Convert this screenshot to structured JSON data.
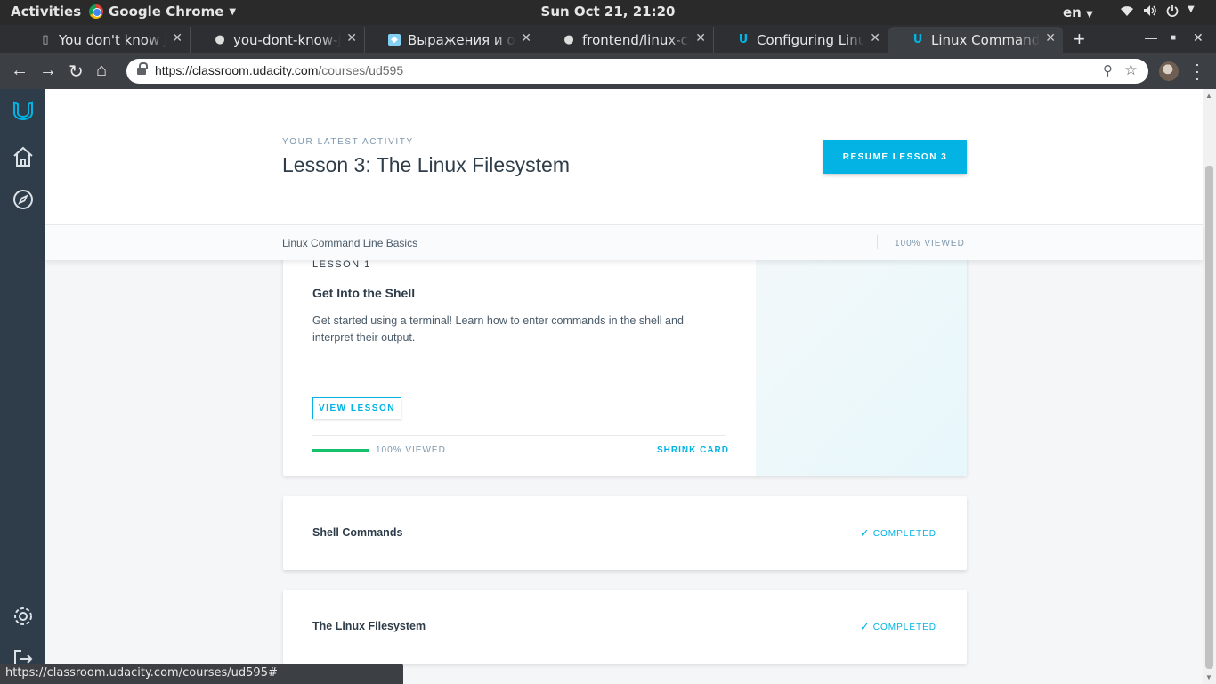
{
  "system_bar": {
    "activities": "Activities",
    "app_name": "Google Chrome",
    "clock": "Sun Oct 21, 21:20",
    "lang": "en"
  },
  "tabs": [
    {
      "title": "You don't know JS",
      "icon": "document-icon"
    },
    {
      "title": "you-dont-know-js-ru",
      "icon": "github-icon"
    },
    {
      "title": "Выражения и операторы",
      "icon": "mdn-icon"
    },
    {
      "title": "frontend/linux-cli-hw",
      "icon": "github-icon"
    },
    {
      "title": "Configuring Linux Web",
      "icon": "udacity-icon"
    },
    {
      "title": "Linux Command Line",
      "icon": "udacity-icon",
      "active": true
    }
  ],
  "address_bar": {
    "host": "https://classroom.udacity.com",
    "path": "/courses/ud595"
  },
  "header": {
    "kicker": "YOUR LATEST ACTIVITY",
    "title": "Lesson 3: The Linux Filesystem",
    "resume_label": "RESUME LESSON 3"
  },
  "subbar": {
    "course": "Linux Command Line Basics",
    "viewed": "100% VIEWED"
  },
  "lessons": [
    {
      "number": "LESSON 1",
      "name": "Get Into the Shell",
      "description": "Get started using a terminal! Learn how to enter commands in the shell and interpret their output.",
      "view_label": "VIEW LESSON",
      "progress_pct": 100,
      "progress_label": "100% VIEWED",
      "shrink_label": "SHRINK CARD"
    },
    {
      "name": "Shell Commands",
      "status": "COMPLETED"
    },
    {
      "name": "The Linux Filesystem",
      "status": "COMPLETED"
    }
  ],
  "status_url": "https://classroom.udacity.com/courses/ud595#",
  "colors": {
    "accent": "#02b3e4",
    "nav_bg": "#2e3d49",
    "progress": "#15c26b"
  }
}
